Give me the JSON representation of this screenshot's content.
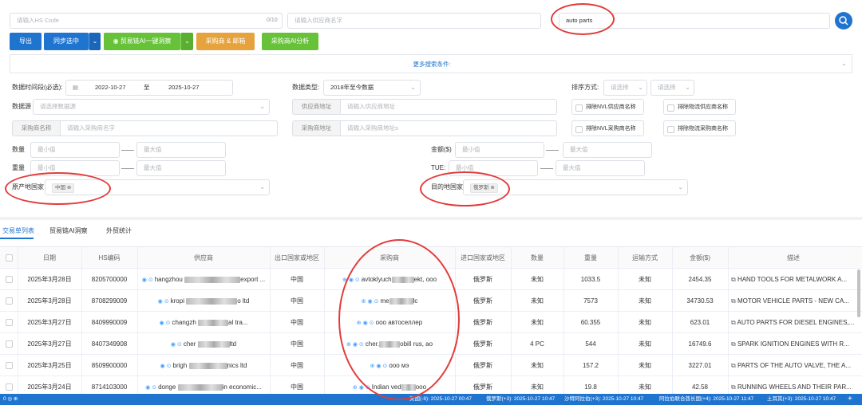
{
  "search": {
    "hs_placeholder": "请输入HS Code",
    "hs_counter": "0/10",
    "supplier_placeholder": "请输入供应商名字",
    "keyword_value": "auto parts"
  },
  "toolbar": {
    "export": "导出",
    "sync": "同步选中",
    "ai_insight": "贸易链AI一键洞察",
    "buyer_email": "采购商 & 邮箱",
    "buyer_ai": "采购商AI分析"
  },
  "more_search": "更多搜索条件:",
  "filters": {
    "date_label": "数据时间段(必选):",
    "date_from": "2022-10-27",
    "date_to_label": "至",
    "date_to": "2025-10-27",
    "data_type_label": "数据类型:",
    "data_type_value": "2018年至今数据",
    "sort_label": "排序方式:",
    "sort_placeholder_1": "请选择",
    "sort_placeholder_2": "请选择",
    "source_label": "数据源",
    "source_placeholder": "请选择数据源",
    "supplier_addr_tag": "供应商地址",
    "supplier_addr_placeholder": "请输入供应商地址",
    "buyer_name_tag": "采购商名称",
    "buyer_name_placeholder": "请输入采购商名字",
    "buyer_addr_tag": "采购商地址",
    "buyer_addr_placeholder": "请输入采购商地址s",
    "exclude_nvl_supplier": "排除NVL供应商名称",
    "exclude_logistics_supplier": "排除物流供应商名称",
    "exclude_nvl_buyer": "排除NVL采购商名称",
    "exclude_logistics_buyer": "排除物流采购商名称",
    "qty_label": "数量",
    "amount_label": "金额($)",
    "weight_label": "重量",
    "teu_label": "TUE:",
    "min_placeholder": "最小值",
    "max_placeholder": "最大值",
    "origin_label": "原产地国家",
    "origin_tag": "中国",
    "dest_label": "目的地国家",
    "dest_tag": "俄罗斯"
  },
  "tabs": [
    "交易单列表",
    "贸易链AI洞察",
    "外贸统计"
  ],
  "table": {
    "headers": [
      "日期",
      "HS编码",
      "供应商",
      "出口国家或地区",
      "采购商",
      "进口国家或地区",
      "数量",
      "重量",
      "运输方式",
      "金额($)",
      "描述"
    ],
    "rows": [
      {
        "date": "2025年3月28日",
        "hs": "8205700000",
        "sup_a": "hangzhou",
        "sup_b": "export ...",
        "exp": "中国",
        "buy_a": "avtoklyuch",
        "buy_b": "ekt, ooo",
        "imp": "俄罗斯",
        "qty": "未知",
        "weight": "1033.5",
        "mode": "未知",
        "amount": "2454.35",
        "desc": "HAND TOOLS FOR METALWORK A..."
      },
      {
        "date": "2025年3月28日",
        "hs": "8708299009",
        "sup_a": "kropi",
        "sup_b": "o ltd",
        "exp": "中国",
        "buy_a": "me",
        "buy_b": "lc",
        "imp": "俄罗斯",
        "qty": "未知",
        "weight": "7573",
        "mode": "未知",
        "amount": "34730.53",
        "desc": "MOTOR VEHICLE PARTS - NEW CA..."
      },
      {
        "date": "2025年3月27日",
        "hs": "8409990009",
        "sup_a": "changzh",
        "sup_b": "al tra...",
        "exp": "中国",
        "buy_a": "ооо автоселлер",
        "buy_b": "",
        "imp": "俄罗斯",
        "qty": "未知",
        "weight": "60.355",
        "mode": "未知",
        "amount": "623.01",
        "desc": "AUTO PARTS FOR DIESEL ENGINES,..."
      },
      {
        "date": "2025年3月27日",
        "hs": "8407349908",
        "sup_a": "cher",
        "sup_b": "ltd",
        "exp": "中国",
        "buy_a": "cher.",
        "buy_b": "obill rus, ao",
        "imp": "俄罗斯",
        "qty": "4 PC",
        "weight": "544",
        "mode": "未知",
        "amount": "16749.6",
        "desc": "SPARK IGNITION ENGINES WITH R..."
      },
      {
        "date": "2025年3月25日",
        "hs": "8509900000",
        "sup_a": "brigh",
        "sup_b": "nics ltd",
        "exp": "中国",
        "buy_a": "ооо мэ",
        "buy_b": "",
        "imp": "俄罗斯",
        "qty": "未知",
        "weight": "157.2",
        "mode": "未知",
        "amount": "3227.01",
        "desc": "PARTS OF THE AUTO VALVE, THE A..."
      },
      {
        "date": "2025年3月24日",
        "hs": "8714103000",
        "sup_a": "donge",
        "sup_b": "in economic...",
        "exp": "中国",
        "buy_a": "Indian ved",
        "buy_b": "ooo",
        "imp": "俄罗斯",
        "qty": "未知",
        "weight": "19.8",
        "mode": "未知",
        "amount": "42.58",
        "desc": "RUNNING WHEELS AND THEIR PAR..."
      }
    ]
  },
  "statusbar": {
    "left": "0 ◎ ⊕",
    "items": [
      "美国(-8): 2025-10-27 00:47",
      "俄罗斯(+3): 2025-10-27 10:47",
      "沙特阿拉伯(+3): 2025-10-27 10:47",
      "阿拉伯联合酋长国(+4): 2025-10-27 11:47",
      "土耳其(+3): 2025-10-27 10:47"
    ]
  },
  "colors": {
    "primary": "#1f74d0",
    "green": "#67c23a",
    "orange": "#e6a23c",
    "annotation": "#e23b3b"
  }
}
